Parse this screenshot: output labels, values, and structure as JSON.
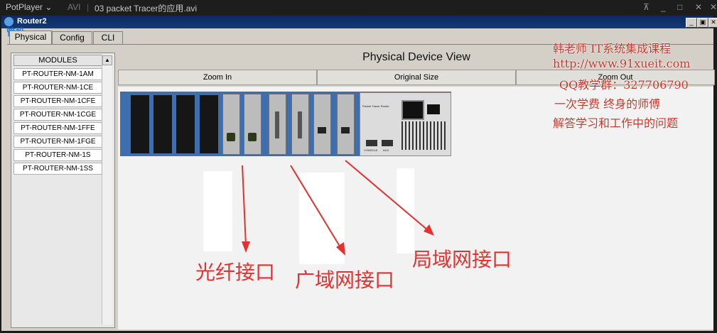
{
  "potplayer": {
    "app_name": "PotPlayer",
    "format": "AVI",
    "file_title": "03 packet Tracer的应用.avi",
    "controls": [
      "⊼",
      "_",
      "□",
      "✕"
    ]
  },
  "pt_window": {
    "title": "Router2",
    "overlay_text": "管投",
    "buttons": [
      "_",
      "▣",
      "✕"
    ],
    "tabs": [
      "Physical",
      "Config",
      "CLI"
    ],
    "modules_header": "MODULES",
    "modules": [
      "PT-ROUTER-NM-1AM",
      "PT-ROUTER-NM-1CE",
      "PT-ROUTER-NM-1CFE",
      "PT-ROUTER-NM-1CGE",
      "PT-ROUTER-NM-1FFE",
      "PT-ROUTER-NM-1FGE",
      "PT-ROUTER-NM-1S",
      "PT-ROUTER-NM-1SS"
    ],
    "view_title": "Physical Device View",
    "view_buttons": [
      "Zoom In",
      "Original Size",
      "Zoom Out"
    ],
    "device_label": "Packet Tracer Router",
    "port_labels": [
      "CONSOLE",
      "AUX"
    ]
  },
  "watermark": [
    "韩老师 IT系统集成课程",
    "http://www.91xueit.com",
    "QQ教学群：327706790",
    "一次学费  终身的师傅",
    "解答学习和工作中的问题"
  ],
  "annotations": [
    "光纤接口",
    "广域网接口",
    "局域网接口"
  ],
  "colors": {
    "annotation": "#e53030",
    "device_blue": "#3d6fb0",
    "title_bar": "#0d2a5e"
  }
}
